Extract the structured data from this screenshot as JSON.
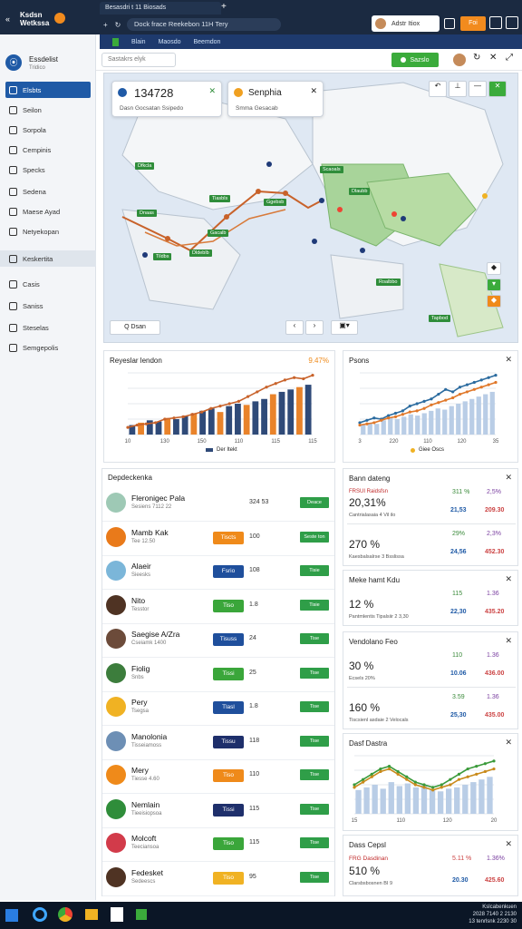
{
  "browser": {
    "brand_line1": "Ksdsn",
    "brand_line2": "Wetkssa",
    "tab_title": "Besasdri t 11 Biosads",
    "address": "Dock frace Reekebon 11H Tery",
    "user_name": "Adstr Itiox",
    "orange_label": "Foi",
    "bookmarks": [
      "Blain",
      "Maosdo",
      "Beemdon"
    ]
  },
  "sidebar": {
    "header_title": "Essdelist",
    "header_sub": "Tridico",
    "items": [
      {
        "label": "Elsbts",
        "state": "active"
      },
      {
        "label": "Seilon",
        "state": ""
      },
      {
        "label": "Sorpola",
        "state": ""
      },
      {
        "label": "Cempinis",
        "state": ""
      },
      {
        "label": "Specks",
        "state": ""
      },
      {
        "label": "Sedena",
        "state": ""
      },
      {
        "label": "Maese Ayad",
        "state": ""
      },
      {
        "label": "Netyekopan",
        "state": ""
      },
      {
        "label": "Keskertita",
        "state": "hl"
      },
      {
        "label": "Casis",
        "state": ""
      },
      {
        "label": "Saniss",
        "state": ""
      },
      {
        "label": "Steselas",
        "state": ""
      },
      {
        "label": "Semgepolis",
        "state": ""
      }
    ]
  },
  "toolbar": {
    "search_placeholder": "Sastakrs elyk",
    "green_label": "Sazslo"
  },
  "map": {
    "card1_value": "134728",
    "card1_sub": "Dasn Gocsatan Ssipedo",
    "card2_title": "Senphia",
    "card2_sub": "Smma Gesacab",
    "zoom_label": "Q Dsan",
    "tags": [
      "Dfkcla",
      "Tiasbls",
      "Ggebsb",
      "Dnaas",
      "Gacalb",
      "Tildbs",
      "Dldeblb",
      "Scaoals",
      "Dlaubb",
      "Roalbbo",
      "Tapbod"
    ]
  },
  "revenue_chart": {
    "title": "Reyeslar lendon",
    "badge": "9.47%",
    "legend": "Der Itekt",
    "x_ticks": [
      "10",
      "130",
      "150",
      "110",
      "115",
      "115"
    ],
    "chart_data": {
      "type": "bar",
      "values": [
        8,
        10,
        12,
        11,
        14,
        13,
        16,
        18,
        20,
        22,
        19,
        24,
        26,
        25,
        28,
        30,
        34,
        36,
        38,
        40,
        42
      ],
      "line": [
        6,
        8,
        9,
        10,
        13,
        14,
        15,
        17,
        19,
        22,
        24,
        26,
        28,
        32,
        36,
        40,
        43,
        46,
        48,
        47,
        50
      ],
      "ylim": [
        0,
        52
      ]
    }
  },
  "side_chart": {
    "title": "Psons",
    "legend": "Giee Oscs",
    "x_ticks": [
      "3",
      "220",
      "110",
      "120",
      "35"
    ],
    "chart_data": {
      "type": "bar",
      "values": [
        8,
        10,
        9,
        12,
        14,
        13,
        15,
        17,
        16,
        18,
        20,
        22,
        21,
        24,
        26,
        28,
        30,
        32,
        34,
        36
      ],
      "line1": [
        10,
        12,
        14,
        13,
        16,
        18,
        20,
        24,
        26,
        28,
        30,
        34,
        38,
        36,
        40,
        42,
        44,
        46,
        48,
        50
      ],
      "line2": [
        8,
        9,
        10,
        12,
        14,
        15,
        17,
        19,
        20,
        22,
        25,
        27,
        29,
        31,
        34,
        36,
        38,
        40,
        42,
        44
      ],
      "ylim": [
        0,
        52
      ]
    }
  },
  "list": {
    "title": "Depdeckenka",
    "rows": [
      {
        "name": "Fleronigec Pala",
        "sub": "Sesiens 7112 22",
        "num": "324 53",
        "badge": "",
        "badge_color": "",
        "btn": "Deace",
        "avatar": "#9ec9b5"
      },
      {
        "name": "Mamb Kak",
        "sub": "Tee 12.50",
        "num": "100",
        "badge": "Tiscts",
        "badge_color": "#ef8a1a",
        "btn": "Seste ton",
        "avatar": "#e97a1a"
      },
      {
        "name": "Alaeir",
        "sub": "Sieesks",
        "num": "108",
        "badge": "Fsrio",
        "badge_color": "#1f4f9c",
        "btn": "Tisie",
        "avatar": "#7bb6d9"
      },
      {
        "name": "Nito",
        "sub": "Tesstor",
        "num": "1.8",
        "badge": "Tiso",
        "badge_color": "#3aa63a",
        "btn": "Tisie",
        "avatar": "#4f3323"
      },
      {
        "name": "Saegise A/Zra",
        "sub": "Cseiamk 1400",
        "num": "24",
        "badge": "Tisuss",
        "badge_color": "#1f4f9c",
        "btn": "Tise",
        "avatar": "#6c4b3a"
      },
      {
        "name": "Fiolig",
        "sub": "Snbs",
        "num": "25",
        "badge": "Tissi",
        "badge_color": "#3aa63a",
        "btn": "Tise",
        "avatar": "#3c7d3c"
      },
      {
        "name": "Pery",
        "sub": "Tsegsa",
        "num": "1.8",
        "badge": "Tlasl",
        "badge_color": "#1f4f9c",
        "btn": "Tise",
        "avatar": "#f0b223"
      },
      {
        "name": "Manolonia",
        "sub": "Tisseiamoss",
        "num": "118",
        "badge": "Tissu",
        "badge_color": "#1e2f6b",
        "btn": "Tise",
        "avatar": "#6d8fb5"
      },
      {
        "name": "Mery",
        "sub": "Tiesse 4.60",
        "num": "110",
        "badge": "Tiso",
        "badge_color": "#ef8a1a",
        "btn": "Tise",
        "avatar": "#ef8a1a"
      },
      {
        "name": "Nemlain",
        "sub": "Tieeisiopsoa",
        "num": "115",
        "badge": "Tissi",
        "badge_color": "#1e2f6b",
        "btn": "Tise",
        "avatar": "#2f8d3a"
      },
      {
        "name": "Molcoft",
        "sub": "Teeciansoa",
        "num": "115",
        "badge": "Tiso",
        "badge_color": "#3aa63a",
        "btn": "Tise",
        "avatar": "#d23b4a"
      },
      {
        "name": "Fedesket",
        "sub": "Sedeescs",
        "num": "95",
        "badge": "Tiso",
        "badge_color": "#f0b223",
        "btn": "Tise",
        "avatar": "#4f3323"
      }
    ]
  },
  "right_panels": [
    {
      "title": "Bann dateng",
      "lines": [
        {
          "label": "FRSUI Raidsfsn",
          "value": "20,31%",
          "sub": "Cantrialasaia 4 Vil ilo",
          "c1": "311 %",
          "c2": "2,5%",
          "c3": "21,53",
          "c4": "209.30"
        },
        {
          "label": "",
          "value": "270 %",
          "sub": "Kaesbalsalrse 3 Bsslissa",
          "c1": "29%",
          "c2": "2,3%",
          "c3": "24,56",
          "c4": "452.30"
        }
      ]
    },
    {
      "title": "Meke hamt Kdu",
      "lines": [
        {
          "label": "",
          "value": "12 %",
          "sub": "Pantmlentis Tipalsiir 2 3,30",
          "c1": "115",
          "c2": "1.36",
          "c3": "22,30",
          "c4": "435.20"
        }
      ]
    },
    {
      "title": "Vendolano Feo",
      "lines": [
        {
          "label": "",
          "value": "30 %",
          "sub": "Ecsels 20%",
          "c1": "110",
          "c2": "1.36",
          "c3": "10.06",
          "c4": "436.00"
        },
        {
          "label": "",
          "value": "160 %",
          "sub": "Tiscsienl asdaie 2 Velocals",
          "c1": "3.59",
          "c2": "1.36",
          "c3": "25,30",
          "c4": "435.00"
        }
      ]
    }
  ],
  "mini_chart": {
    "title": "Dasf Dastra",
    "x_ticks": [
      "15",
      "110",
      "120",
      "20"
    ],
    "chart_data": {
      "type": "bar",
      "values": [
        18,
        20,
        22,
        19,
        24,
        21,
        23,
        20,
        22,
        18,
        17,
        19,
        20,
        22,
        24,
        26,
        28
      ],
      "line1": [
        22,
        26,
        30,
        34,
        36,
        32,
        28,
        24,
        22,
        20,
        22,
        26,
        30,
        34,
        36,
        38,
        40
      ],
      "line2": [
        20,
        24,
        28,
        32,
        34,
        30,
        26,
        22,
        20,
        18,
        20,
        22,
        26,
        28,
        30,
        32,
        34
      ],
      "ylim": [
        0,
        44
      ]
    }
  },
  "bottom_panel": {
    "title": "Dass Cepsl",
    "label": "FRG Dasdinan",
    "value": "510 %",
    "sub": "Clarsbsbosnen BI 9",
    "c1": "5.11 %",
    "c2": "1.36%",
    "c3": "20.30",
    "c4": "425.60"
  },
  "taskbar": {
    "clock1": "Kslcabenkuen",
    "clock2": "2028 7140 2 2130",
    "clock3": "13 tenrlsnk 2230 30"
  },
  "colors": {
    "accent": "#1f5aa6",
    "green": "#3bab3b",
    "orange": "#ef8a1a",
    "navy": "#1b2a41"
  }
}
